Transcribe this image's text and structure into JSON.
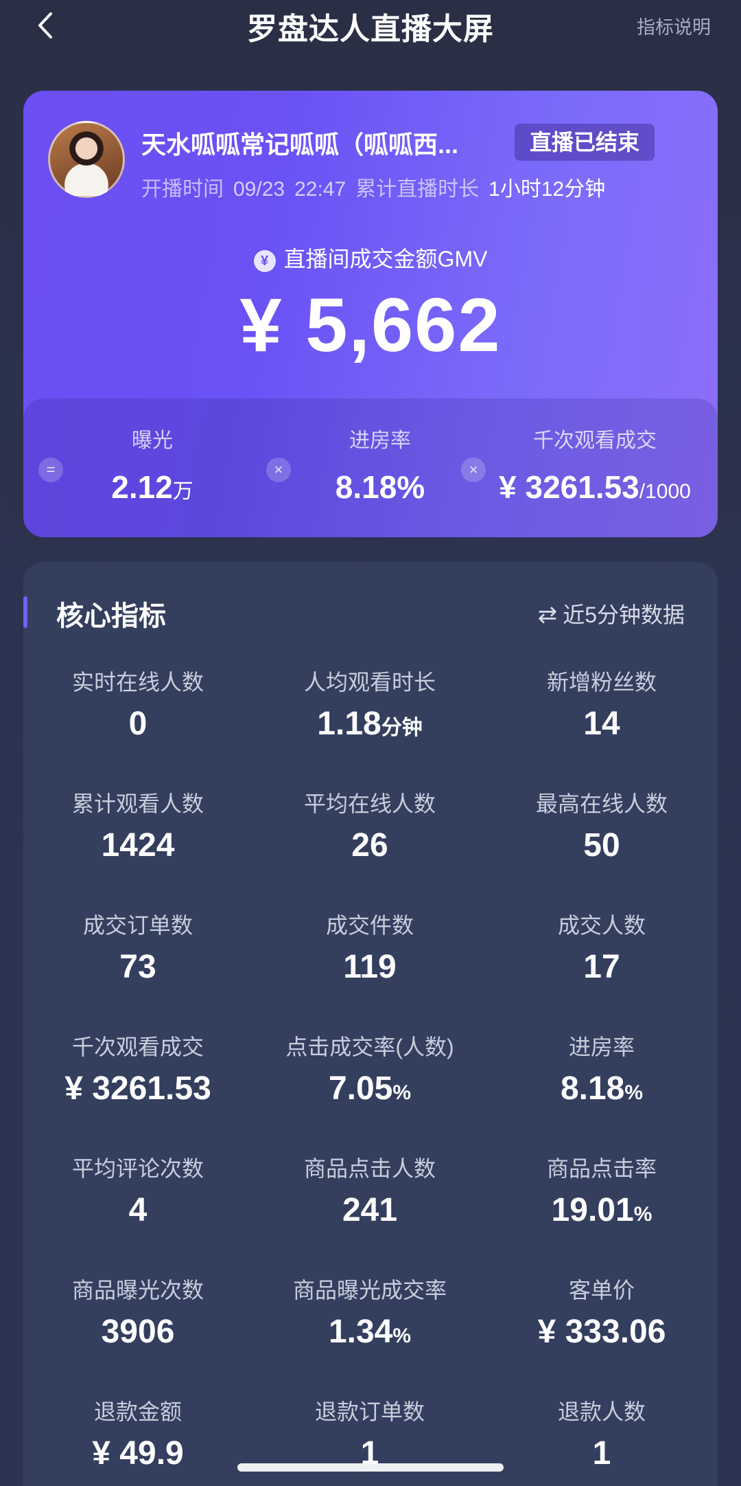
{
  "header": {
    "title": "罗盘达人直播大屏",
    "help_label": "指标说明"
  },
  "anchor": {
    "name": "天水呱呱常记呱呱（呱呱西...",
    "status": "直播已结束",
    "start_label": "开播时间",
    "start_date": "09/23",
    "start_time": "22:47",
    "duration_label": "累计直播时长",
    "duration": "1小时12分钟"
  },
  "gmv": {
    "label": "直播间成交金额GMV",
    "value": "¥ 5,662"
  },
  "sub_metrics": [
    {
      "op": "=",
      "label": "曝光",
      "value": "2.12",
      "unit": "万"
    },
    {
      "op": "×",
      "label": "进房率",
      "value": "8.18%",
      "unit": ""
    },
    {
      "op": "×",
      "label": "千次观看成交",
      "value": "¥ 3261.53",
      "unit": "/1000"
    }
  ],
  "core": {
    "title": "核心指标",
    "refresh_label": "近5分钟数据",
    "metrics": [
      {
        "label": "实时在线人数",
        "value": "0",
        "unit": ""
      },
      {
        "label": "人均观看时长",
        "value": "1.18",
        "unit": "分钟"
      },
      {
        "label": "新增粉丝数",
        "value": "14",
        "unit": ""
      },
      {
        "label": "累计观看人数",
        "value": "1424",
        "unit": ""
      },
      {
        "label": "平均在线人数",
        "value": "26",
        "unit": ""
      },
      {
        "label": "最高在线人数",
        "value": "50",
        "unit": ""
      },
      {
        "label": "成交订单数",
        "value": "73",
        "unit": ""
      },
      {
        "label": "成交件数",
        "value": "119",
        "unit": ""
      },
      {
        "label": "成交人数",
        "value": "17",
        "unit": ""
      },
      {
        "label": "千次观看成交",
        "value": "¥ 3261.53",
        "unit": ""
      },
      {
        "label": "点击成交率(人数)",
        "value": "7.05",
        "unit": "%"
      },
      {
        "label": "进房率",
        "value": "8.18",
        "unit": "%"
      },
      {
        "label": "平均评论次数",
        "value": "4",
        "unit": ""
      },
      {
        "label": "商品点击人数",
        "value": "241",
        "unit": ""
      },
      {
        "label": "商品点击率",
        "value": "19.01",
        "unit": "%"
      },
      {
        "label": "商品曝光次数",
        "value": "3906",
        "unit": ""
      },
      {
        "label": "商品曝光成交率",
        "value": "1.34",
        "unit": "%"
      },
      {
        "label": "客单价",
        "value": "¥ 333.06",
        "unit": ""
      },
      {
        "label": "退款金额",
        "value": "¥ 49.9",
        "unit": ""
      },
      {
        "label": "退款订单数",
        "value": "1",
        "unit": ""
      },
      {
        "label": "退款人数",
        "value": "1",
        "unit": ""
      }
    ]
  }
}
